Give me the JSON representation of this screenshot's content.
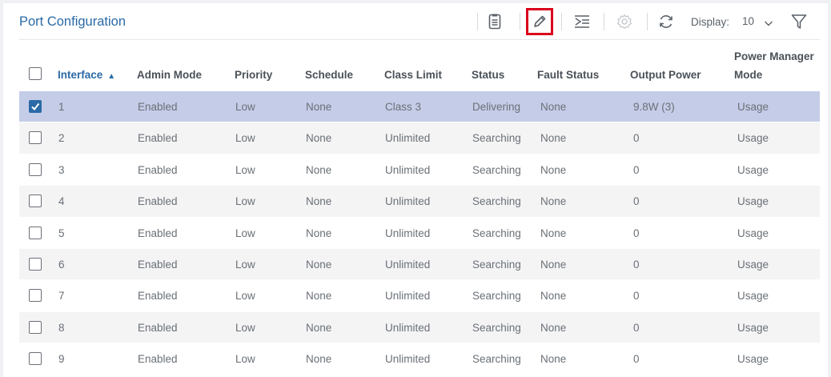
{
  "header": {
    "title": "Port Configuration",
    "display_label": "Display:",
    "display_value": "10",
    "icons": [
      "document-icon",
      "edit-icon",
      "column-settings-icon",
      "gear-icon",
      "refresh-icon",
      "filter-icon"
    ]
  },
  "colors": {
    "accent": "#2a6aa6",
    "selected_row": "#c5cce8",
    "highlight_border": "#d9001b"
  },
  "table": {
    "columns": [
      "Interface",
      "Admin Mode",
      "Priority",
      "Schedule",
      "Class Limit",
      "Status",
      "Fault Status",
      "Output Power",
      "Power Manager",
      "Mode"
    ],
    "rows": [
      {
        "interface": "1",
        "admin": "Enabled",
        "priority": "Low",
        "schedule": "None",
        "class_limit": "Class 3",
        "status": "Delivering",
        "fault": "None",
        "power": "9.8W (3)",
        "mode": "Usage"
      },
      {
        "interface": "2",
        "admin": "Enabled",
        "priority": "Low",
        "schedule": "None",
        "class_limit": "Unlimited",
        "status": "Searching",
        "fault": "None",
        "power": "0",
        "mode": "Usage"
      },
      {
        "interface": "3",
        "admin": "Enabled",
        "priority": "Low",
        "schedule": "None",
        "class_limit": "Unlimited",
        "status": "Searching",
        "fault": "None",
        "power": "0",
        "mode": "Usage"
      },
      {
        "interface": "4",
        "admin": "Enabled",
        "priority": "Low",
        "schedule": "None",
        "class_limit": "Unlimited",
        "status": "Searching",
        "fault": "None",
        "power": "0",
        "mode": "Usage"
      },
      {
        "interface": "5",
        "admin": "Enabled",
        "priority": "Low",
        "schedule": "None",
        "class_limit": "Unlimited",
        "status": "Searching",
        "fault": "None",
        "power": "0",
        "mode": "Usage"
      },
      {
        "interface": "6",
        "admin": "Enabled",
        "priority": "Low",
        "schedule": "None",
        "class_limit": "Unlimited",
        "status": "Searching",
        "fault": "None",
        "power": "0",
        "mode": "Usage"
      },
      {
        "interface": "7",
        "admin": "Enabled",
        "priority": "Low",
        "schedule": "None",
        "class_limit": "Unlimited",
        "status": "Searching",
        "fault": "None",
        "power": "0",
        "mode": "Usage"
      },
      {
        "interface": "8",
        "admin": "Enabled",
        "priority": "Low",
        "schedule": "None",
        "class_limit": "Unlimited",
        "status": "Searching",
        "fault": "None",
        "power": "0",
        "mode": "Usage"
      },
      {
        "interface": "9",
        "admin": "Enabled",
        "priority": "Low",
        "schedule": "None",
        "class_limit": "Unlimited",
        "status": "Searching",
        "fault": "None",
        "power": "0",
        "mode": "Usage"
      }
    ]
  }
}
